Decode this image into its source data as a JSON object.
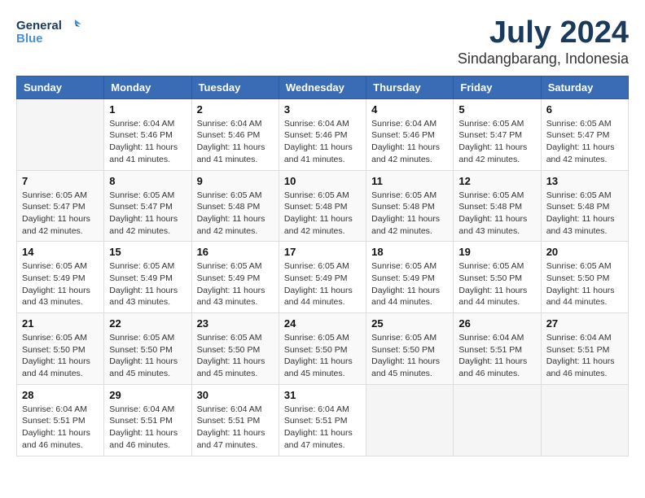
{
  "logo": {
    "line1": "General",
    "line2": "Blue"
  },
  "title": "July 2024",
  "location": "Sindangbarang, Indonesia",
  "headers": [
    "Sunday",
    "Monday",
    "Tuesday",
    "Wednesday",
    "Thursday",
    "Friday",
    "Saturday"
  ],
  "weeks": [
    [
      {
        "day": "",
        "info": ""
      },
      {
        "day": "1",
        "info": "Sunrise: 6:04 AM\nSunset: 5:46 PM\nDaylight: 11 hours\nand 41 minutes."
      },
      {
        "day": "2",
        "info": "Sunrise: 6:04 AM\nSunset: 5:46 PM\nDaylight: 11 hours\nand 41 minutes."
      },
      {
        "day": "3",
        "info": "Sunrise: 6:04 AM\nSunset: 5:46 PM\nDaylight: 11 hours\nand 41 minutes."
      },
      {
        "day": "4",
        "info": "Sunrise: 6:04 AM\nSunset: 5:46 PM\nDaylight: 11 hours\nand 42 minutes."
      },
      {
        "day": "5",
        "info": "Sunrise: 6:05 AM\nSunset: 5:47 PM\nDaylight: 11 hours\nand 42 minutes."
      },
      {
        "day": "6",
        "info": "Sunrise: 6:05 AM\nSunset: 5:47 PM\nDaylight: 11 hours\nand 42 minutes."
      }
    ],
    [
      {
        "day": "7",
        "info": "Sunrise: 6:05 AM\nSunset: 5:47 PM\nDaylight: 11 hours\nand 42 minutes."
      },
      {
        "day": "8",
        "info": "Sunrise: 6:05 AM\nSunset: 5:47 PM\nDaylight: 11 hours\nand 42 minutes."
      },
      {
        "day": "9",
        "info": "Sunrise: 6:05 AM\nSunset: 5:48 PM\nDaylight: 11 hours\nand 42 minutes."
      },
      {
        "day": "10",
        "info": "Sunrise: 6:05 AM\nSunset: 5:48 PM\nDaylight: 11 hours\nand 42 minutes."
      },
      {
        "day": "11",
        "info": "Sunrise: 6:05 AM\nSunset: 5:48 PM\nDaylight: 11 hours\nand 42 minutes."
      },
      {
        "day": "12",
        "info": "Sunrise: 6:05 AM\nSunset: 5:48 PM\nDaylight: 11 hours\nand 43 minutes."
      },
      {
        "day": "13",
        "info": "Sunrise: 6:05 AM\nSunset: 5:48 PM\nDaylight: 11 hours\nand 43 minutes."
      }
    ],
    [
      {
        "day": "14",
        "info": "Sunrise: 6:05 AM\nSunset: 5:49 PM\nDaylight: 11 hours\nand 43 minutes."
      },
      {
        "day": "15",
        "info": "Sunrise: 6:05 AM\nSunset: 5:49 PM\nDaylight: 11 hours\nand 43 minutes."
      },
      {
        "day": "16",
        "info": "Sunrise: 6:05 AM\nSunset: 5:49 PM\nDaylight: 11 hours\nand 43 minutes."
      },
      {
        "day": "17",
        "info": "Sunrise: 6:05 AM\nSunset: 5:49 PM\nDaylight: 11 hours\nand 44 minutes."
      },
      {
        "day": "18",
        "info": "Sunrise: 6:05 AM\nSunset: 5:49 PM\nDaylight: 11 hours\nand 44 minutes."
      },
      {
        "day": "19",
        "info": "Sunrise: 6:05 AM\nSunset: 5:50 PM\nDaylight: 11 hours\nand 44 minutes."
      },
      {
        "day": "20",
        "info": "Sunrise: 6:05 AM\nSunset: 5:50 PM\nDaylight: 11 hours\nand 44 minutes."
      }
    ],
    [
      {
        "day": "21",
        "info": "Sunrise: 6:05 AM\nSunset: 5:50 PM\nDaylight: 11 hours\nand 44 minutes."
      },
      {
        "day": "22",
        "info": "Sunrise: 6:05 AM\nSunset: 5:50 PM\nDaylight: 11 hours\nand 45 minutes."
      },
      {
        "day": "23",
        "info": "Sunrise: 6:05 AM\nSunset: 5:50 PM\nDaylight: 11 hours\nand 45 minutes."
      },
      {
        "day": "24",
        "info": "Sunrise: 6:05 AM\nSunset: 5:50 PM\nDaylight: 11 hours\nand 45 minutes."
      },
      {
        "day": "25",
        "info": "Sunrise: 6:05 AM\nSunset: 5:50 PM\nDaylight: 11 hours\nand 45 minutes."
      },
      {
        "day": "26",
        "info": "Sunrise: 6:04 AM\nSunset: 5:51 PM\nDaylight: 11 hours\nand 46 minutes."
      },
      {
        "day": "27",
        "info": "Sunrise: 6:04 AM\nSunset: 5:51 PM\nDaylight: 11 hours\nand 46 minutes."
      }
    ],
    [
      {
        "day": "28",
        "info": "Sunrise: 6:04 AM\nSunset: 5:51 PM\nDaylight: 11 hours\nand 46 minutes."
      },
      {
        "day": "29",
        "info": "Sunrise: 6:04 AM\nSunset: 5:51 PM\nDaylight: 11 hours\nand 46 minutes."
      },
      {
        "day": "30",
        "info": "Sunrise: 6:04 AM\nSunset: 5:51 PM\nDaylight: 11 hours\nand 47 minutes."
      },
      {
        "day": "31",
        "info": "Sunrise: 6:04 AM\nSunset: 5:51 PM\nDaylight: 11 hours\nand 47 minutes."
      },
      {
        "day": "",
        "info": ""
      },
      {
        "day": "",
        "info": ""
      },
      {
        "day": "",
        "info": ""
      }
    ]
  ]
}
